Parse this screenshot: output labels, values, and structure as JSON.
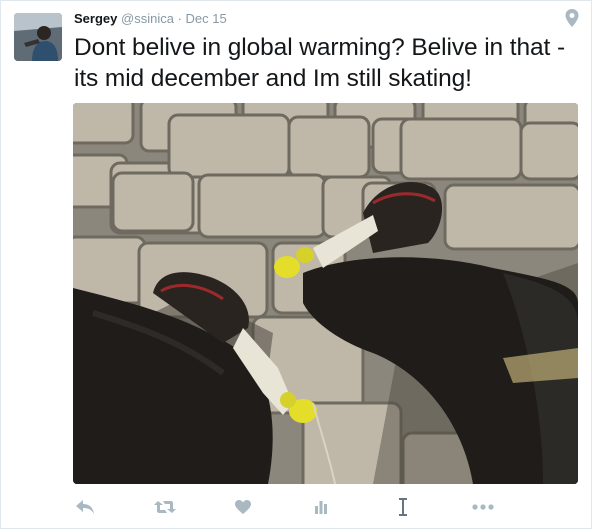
{
  "tweet": {
    "name": "Sergey",
    "handle": "@ssinica",
    "separator": "·",
    "date": "Dec 15",
    "text": "Dont belive in global warming? Belive in that - its mid december and Im still skating!"
  },
  "actions": {
    "icons": [
      "reply-icon",
      "retweet-icon",
      "like-icon",
      "analytics-icon",
      "cursor-text-icon",
      "more-icon"
    ]
  },
  "colors": {
    "icon_grey": "#aab8c2",
    "meta_grey": "#8899a6",
    "text": "#14171a",
    "border": "#e1e8ed"
  }
}
